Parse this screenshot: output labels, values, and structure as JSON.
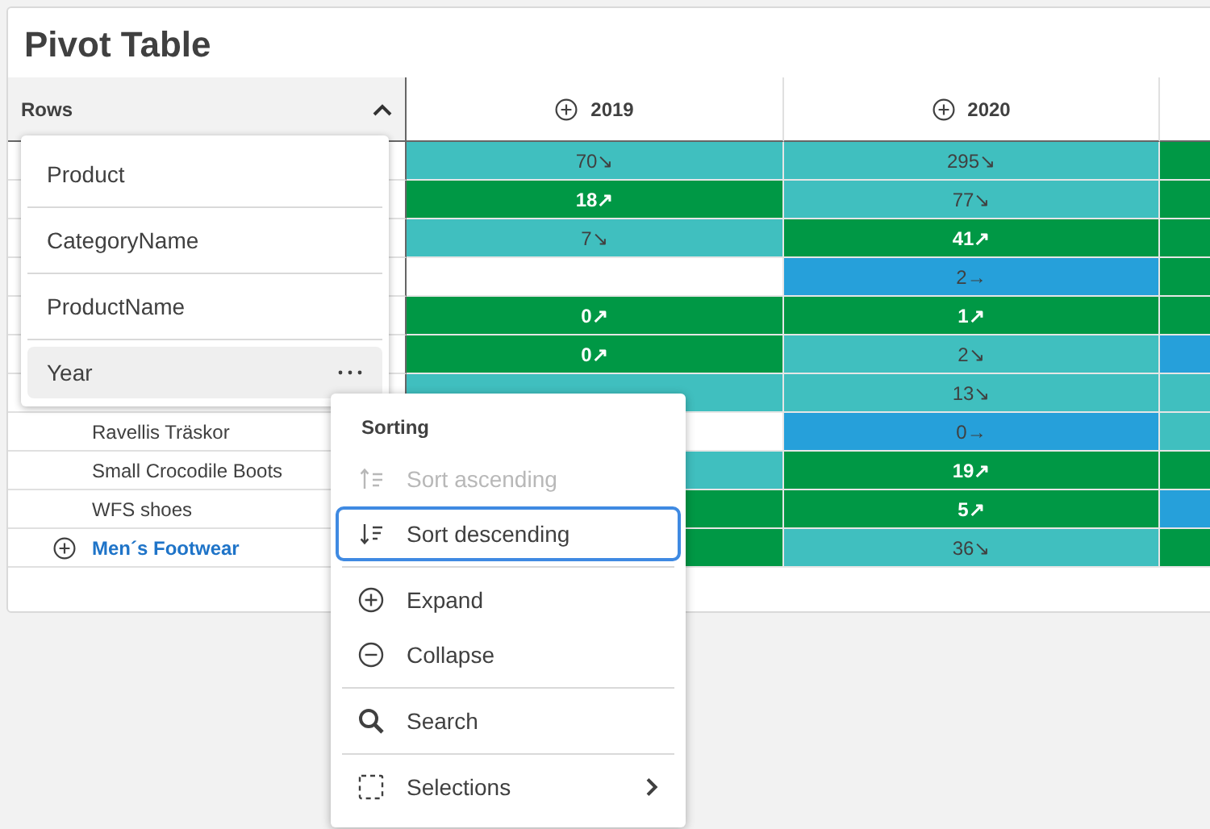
{
  "title": "Pivot Table",
  "rows_header": {
    "label": "Rows",
    "expanded": true
  },
  "columns": [
    {
      "label": "2019"
    },
    {
      "label": "2020"
    }
  ],
  "rows": [
    {
      "cells": [
        {
          "value": "70↘",
          "color": "#40bfbf"
        },
        {
          "value": "295↘",
          "color": "#40bfbf"
        },
        {
          "color": "#009845"
        }
      ]
    },
    {
      "cells": [
        {
          "value": "18↗",
          "color": "#009845"
        },
        {
          "value": "77↘",
          "color": "#40bfbf"
        },
        {
          "color": "#009845"
        }
      ]
    },
    {
      "cells": [
        {
          "value": "7↘",
          "color": "#40bfbf"
        },
        {
          "value": "41↗",
          "color": "#009845"
        },
        {
          "color": "#009845"
        }
      ]
    },
    {
      "cells": [
        {
          "color": "#ffffff"
        },
        {
          "value": "2→",
          "color": "#26a0da"
        },
        {
          "color": "#009845"
        }
      ]
    },
    {
      "cells": [
        {
          "value": "0↗",
          "color": "#009845"
        },
        {
          "value": "1↗",
          "color": "#009845"
        },
        {
          "color": "#009845"
        }
      ]
    },
    {
      "cells": [
        {
          "value": "0↗",
          "color": "#009845"
        },
        {
          "value": "2↘",
          "color": "#40bfbf"
        },
        {
          "color": "#26a0da"
        }
      ]
    },
    {
      "cells": [
        {
          "color": "#40bfbf"
        },
        {
          "value": "13↘",
          "color": "#40bfbf"
        },
        {
          "color": "#40bfbf"
        }
      ]
    },
    {
      "label": "Ravellis Träskor",
      "kind": "leaf",
      "cells": [
        {
          "color": "#ffffff"
        },
        {
          "value": "0→",
          "color": "#26a0da"
        },
        {
          "color": "#40bfbf"
        }
      ]
    },
    {
      "label": "Small Crocodile Boots",
      "kind": "leaf",
      "cells": [
        {
          "color": "#40bfbf"
        },
        {
          "value": "19↗",
          "color": "#009845"
        },
        {
          "color": "#009845"
        }
      ]
    },
    {
      "label": "WFS shoes",
      "kind": "leaf",
      "cells": [
        {
          "color": "#009845"
        },
        {
          "value": "5↗",
          "color": "#009845"
        },
        {
          "color": "#26a0da"
        }
      ]
    },
    {
      "label": "Men´s Footwear",
      "kind": "group",
      "cells": [
        {
          "color": "#009845"
        },
        {
          "value": "36↘",
          "color": "#40bfbf"
        },
        {
          "color": "#009845"
        }
      ]
    }
  ],
  "field_list": {
    "items": [
      {
        "label": "Product",
        "selected": false
      },
      {
        "label": "CategoryName",
        "selected": false
      },
      {
        "label": "ProductName",
        "selected": false
      },
      {
        "label": "Year",
        "selected": true
      }
    ]
  },
  "context_menu": {
    "sections": [
      {
        "heading": "Sorting",
        "items": [
          {
            "kind": "sort-ascending",
            "label": "Sort ascending",
            "disabled": true,
            "selected": false
          },
          {
            "kind": "sort-descending",
            "label": "Sort descending",
            "disabled": false,
            "selected": true
          }
        ]
      },
      {
        "items": [
          {
            "kind": "expand",
            "label": "Expand",
            "disabled": false,
            "selected": false
          },
          {
            "kind": "collapse",
            "label": "Collapse",
            "disabled": false,
            "selected": false
          }
        ]
      },
      {
        "items": [
          {
            "kind": "search",
            "label": "Search",
            "disabled": false,
            "selected": false
          }
        ]
      },
      {
        "items": [
          {
            "kind": "selections",
            "label": "Selections",
            "disabled": false,
            "selected": false,
            "submenu": true
          }
        ]
      }
    ]
  }
}
